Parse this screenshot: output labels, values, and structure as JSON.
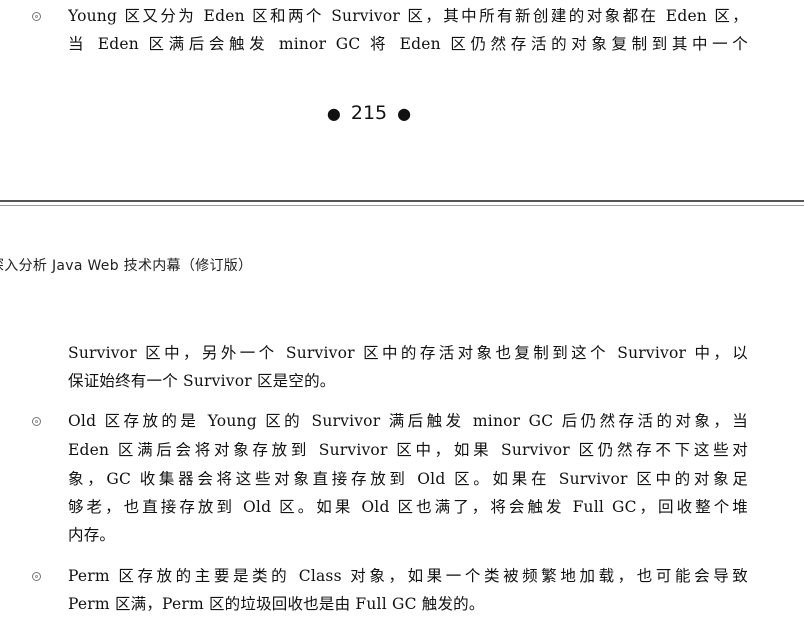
{
  "top_page": {
    "bullet_lines": [
      "Young 区又分为 Eden 区和两个 Survivor 区，其中所有新创建的对象都在 Eden 区，",
      "当 Eden 区满后会触发 minor GC 将 Eden 区仍然存活的对象复制到其中一个"
    ],
    "page_number": "215"
  },
  "bottom_page": {
    "running_header": "深入分析 Java Web 技术内幕（修订版）",
    "continuation_lines": [
      "Survivor 区中，另外一个 Survivor 区中的存活对象也复制到这个 Survivor 中，以",
      "保证始终有一个 Survivor 区是空的。"
    ],
    "bullets": [
      {
        "lines": [
          "Old 区存放的是 Young 区的 Survivor 满后触发 minor GC 后仍然存活的对象，当",
          "Eden 区满后会将对象存放到 Survivor 区中，如果 Survivor 区仍然存不下这些对",
          "象，GC 收集器会将这些对象直接存放到 Old 区。如果在 Survivor 区中的对象足",
          "够老，也直接存放到 Old 区。如果 Old 区也满了，将会触发 Full GC，回收整个堆",
          "内存。"
        ]
      },
      {
        "lines": [
          "Perm 区存放的主要是类的 Class 对象，如果一个类被频繁地加载，也可能会导致",
          "Perm 区满，Perm 区的垃圾回收也是由 Full GC 触发的。"
        ]
      }
    ]
  }
}
